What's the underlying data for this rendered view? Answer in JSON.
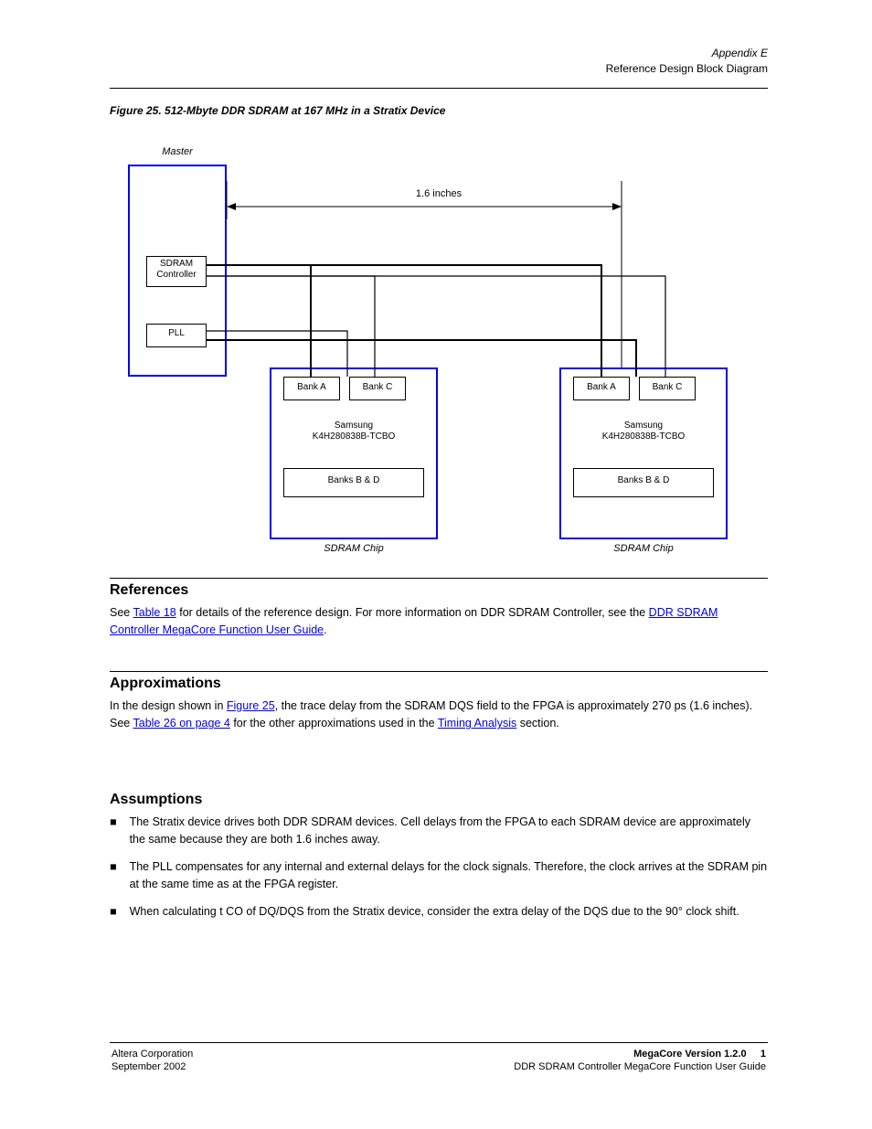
{
  "header": {
    "chapter": "Appendix E",
    "title": "Reference Design Block Diagram"
  },
  "diagram": {
    "figure_label": "Figure 25.  ",
    "figure_title": "512-Mbyte DDR SDRAM at 167 MHz in a Stratix Device",
    "master": {
      "title": "Master",
      "sdram_ctrl": "SDRAM\nController",
      "pll": "PLL"
    },
    "dist_label": "1.6 inches",
    "sdram_a": {
      "title": "SDRAM Chip",
      "bank_a": "Bank A",
      "bank_c": "Bank C",
      "chip": "Samsung\nK4H280838B-TCBO",
      "banks_bd": "Banks B & D"
    },
    "sdram_b": {
      "title": "SDRAM Chip",
      "bank_a": "Bank A",
      "bank_c": "Bank C",
      "chip": "Samsung\nK4H280838B-TCBO",
      "banks_bd": "Banks B & D"
    }
  },
  "sec_ref": {
    "title": "References",
    "body_pre": "See ",
    "link1": "Table 18",
    "body_mid": " for details of the reference design. For more information on DDR SDRAM Controller, see the ",
    "link2": "DDR SDRAM Controller MegaCore Function User Guide",
    "body_post": "."
  },
  "sec_app": {
    "title": "Approximations",
    "body": "In the design shown in ",
    "link": "Figure 25",
    "body2": ", the trace delay from the SDRAM DQS field to the FPGA is approximately 270 ps (1.6 inches). See ",
    "link2": "Table 26 on page 4",
    "body3": " for the other approximations used in the ",
    "link3": "Timing Analysis",
    "body4": " section."
  },
  "sec_assume": {
    "title": "Assumptions",
    "items": [
      "The Stratix device drives both DDR SDRAM devices. Cell delays from the FPGA to each SDRAM device are approximately the same because they are both 1.6 inches away.",
      "The PLL compensates for any internal and external delays for the clock signals. Therefore, the clock arrives at the SDRAM pin at the same time as at the FPGA register.",
      "When calculating t CO  of DQ/DQS from the Stratix device, consider the extra delay of the DQS due to the 90° clock shift."
    ]
  },
  "footer": {
    "left": "Altera Corporation",
    "right_top": "MegaCore Version 1.2.0",
    "right_page": "1",
    "left2": "September 2002",
    "right2": "DDR SDRAM Controller MegaCore Function User Guide"
  }
}
